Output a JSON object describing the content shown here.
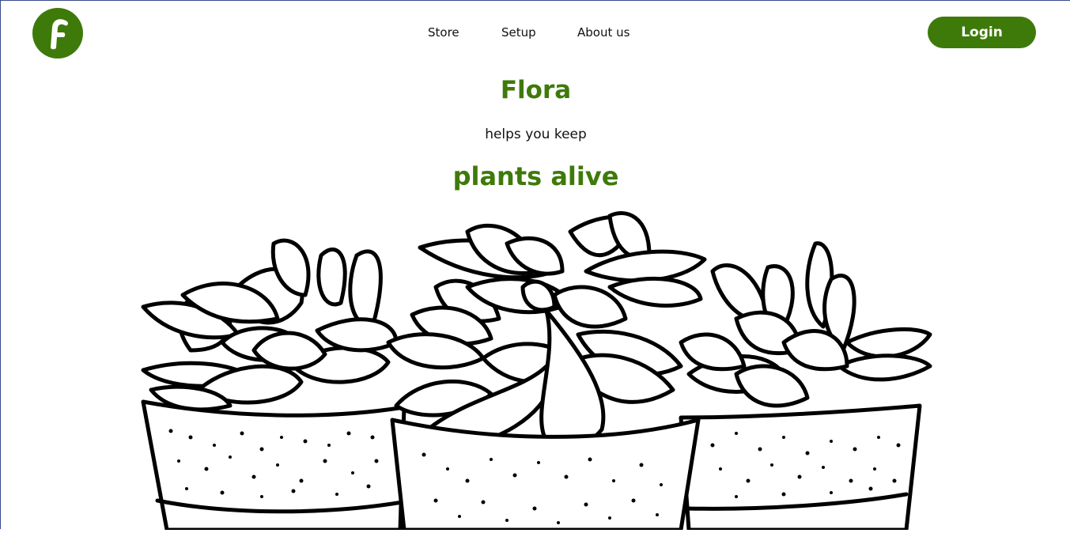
{
  "brand": {
    "logo_letter": "F",
    "color": "#3e7a0a"
  },
  "nav": {
    "items": [
      {
        "label": "Store"
      },
      {
        "label": "Setup"
      },
      {
        "label": "About us"
      }
    ]
  },
  "header": {
    "login_label": "Login"
  },
  "hero": {
    "title": "Flora",
    "subtitle": "helps you keep",
    "accent": "plants alive"
  },
  "illustration": {
    "icon": "succulent-pots-illustration"
  }
}
